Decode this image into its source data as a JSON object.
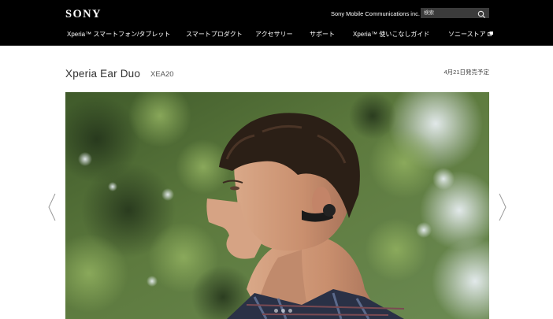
{
  "header": {
    "logo": "SONY",
    "company": "Sony Mobile Communications inc.",
    "search": {
      "placeholder": "検索",
      "value": ""
    },
    "nav": [
      {
        "label": "Xperia™ スマートフォン/タブレット",
        "external": false
      },
      {
        "label": "スマートプロダクト",
        "external": false
      },
      {
        "label": "アクセサリー",
        "external": false
      },
      {
        "label": "サポート",
        "external": false
      },
      {
        "label": "Xperia™ 使いこなしガイド",
        "external": false
      },
      {
        "label": "ソニーストア",
        "external": true
      }
    ]
  },
  "product": {
    "name": "Xperia Ear Duo",
    "model": "XEA20",
    "release": "4月21日発売予定"
  },
  "carousel": {
    "slides_count": 3,
    "active_index": 0,
    "prev_icon": "chevron-left-icon",
    "next_icon": "chevron-right-icon"
  },
  "colors": {
    "header_bg": "#000000",
    "search_bg": "#3b3b3b",
    "text_dark": "#333333"
  }
}
